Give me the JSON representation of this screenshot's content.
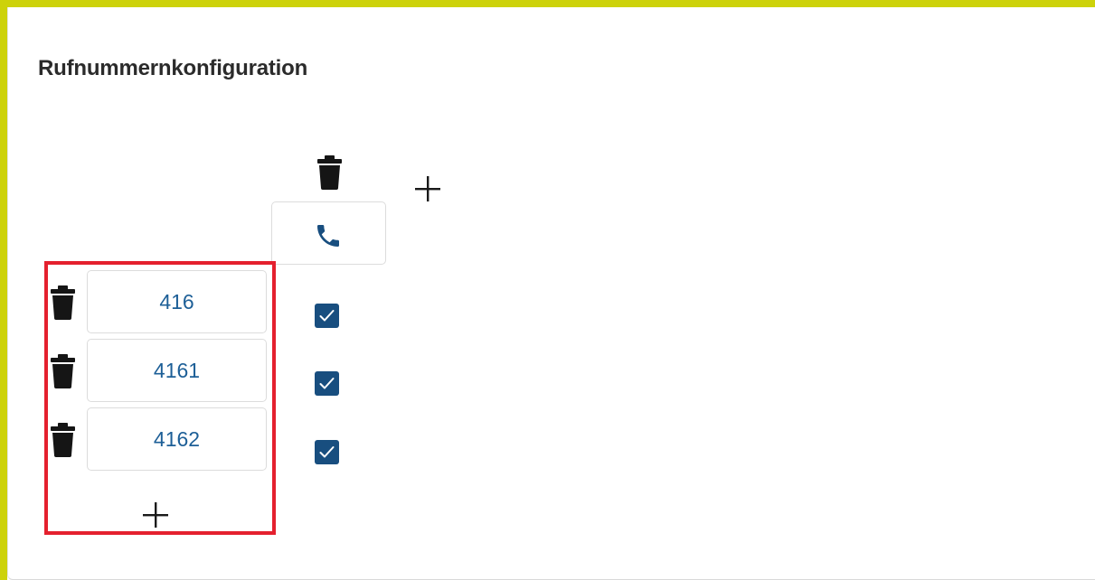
{
  "section": {
    "title": "Rufnummernkonfiguration"
  },
  "column": {
    "delete_icon": "trash-icon",
    "add_icon": "plus-icon",
    "header_icon": "phone-icon"
  },
  "numbers": [
    {
      "value": "416",
      "checked": true
    },
    {
      "value": "4161",
      "checked": true
    },
    {
      "value": "4162",
      "checked": true
    }
  ],
  "row_add_icon": "plus-icon",
  "colors": {
    "accent_border": "#cdd20a",
    "highlight": "#e4202e",
    "checkbox": "#184e7f",
    "number_text": "#1d5f97"
  }
}
